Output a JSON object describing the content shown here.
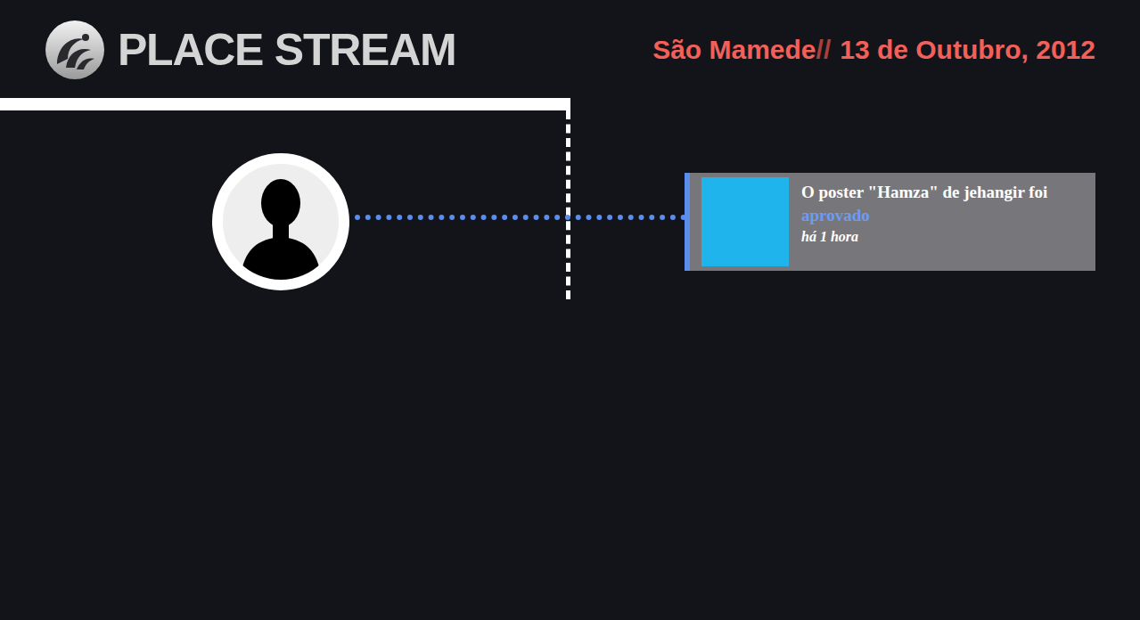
{
  "header": {
    "logo": "PLACE STREAM",
    "location": "São Mamede",
    "separator": "//",
    "date": "13 de Outubro, 2012"
  },
  "events": [
    {
      "message": "O poster \"Hamza\" de jehangir foi",
      "status": "aprovado",
      "time": "há 1 hora"
    }
  ]
}
